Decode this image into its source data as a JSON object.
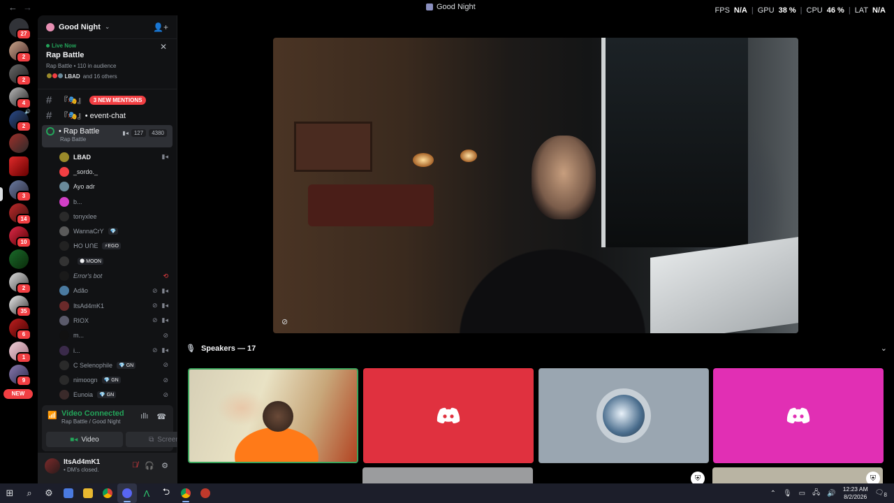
{
  "window": {
    "title": "Good Night"
  },
  "perf": {
    "fps_label": "FPS",
    "fps_value": "N/A",
    "gpu_label": "GPU",
    "gpu_value": "38 %",
    "cpu_label": "CPU",
    "cpu_value": "46 %",
    "lat_label": "LAT",
    "lat_value": "N/A",
    "sep": "|"
  },
  "rail": {
    "badges": [
      "27",
      "2",
      "2",
      "4",
      "2",
      "",
      "",
      "",
      "3",
      "14",
      "10",
      "",
      "2",
      "35",
      "6",
      "1",
      "9"
    ],
    "new_label": "NEW"
  },
  "sidebar": {
    "server_name": "Good Night",
    "live": {
      "live_label": "Live Now",
      "title": "Rap Battle",
      "meta": "Rap Battle • 110 in audience",
      "people_name": "LBAD",
      "people_rest": "and 16 others"
    },
    "channels": [
      {
        "name": "『🎭』",
        "badge": "3 NEW MENTIONS"
      },
      {
        "name": "『🎭』• event-chat"
      }
    ],
    "stage": {
      "name": "• Rap Battle",
      "sub": "Rap Battle",
      "count_a": "127",
      "count_b": "4380"
    },
    "members": [
      {
        "name": "LBAD",
        "color": "#9a8a2a"
      },
      {
        "name": "_sordo._",
        "color": "#f23f43"
      },
      {
        "name": "Ayo adr",
        "color": "#6a8a9a"
      },
      {
        "name": "b...",
        "color": "#d23fc7"
      },
      {
        "name": "tonyxlee",
        "color": "#2a2a2a"
      },
      {
        "name": "WannaCrY",
        "color": "#5a5a5a",
        "tag": "💎"
      },
      {
        "name": "ᕼO ᑌᑎE",
        "color": "#222",
        "tag": "⚡EGO"
      },
      {
        "name": "",
        "color": "#333",
        "tag": "🌑 MOON"
      },
      {
        "name": "Error's bot",
        "color": "#1a1a1a"
      },
      {
        "name": "Adão",
        "color": "#4a7aa0"
      },
      {
        "name": "ItsAd4mK1",
        "color": "#6a2a2a"
      },
      {
        "name": "RIOX",
        "color": "#5a5a6a"
      },
      {
        "name": "m...",
        "color": "#111"
      },
      {
        "name": "i...",
        "color": "#3a2a4a"
      },
      {
        "name": "C Selenophile",
        "color": "#2a2a2a",
        "tag": "💎 GN"
      },
      {
        "name": "nimoogn",
        "color": "#2a2a2a",
        "tag": "💎 GN"
      },
      {
        "name": "Eunoia",
        "color": "#3a2a2a",
        "tag": "💎 GN"
      }
    ],
    "voice": {
      "status": "Video Connected",
      "sub": "Rap Battle / Good Night",
      "video_label": "Video",
      "screen_label": "Screen"
    },
    "user": {
      "name": "ItsAd4mK1",
      "status": "• DM's closed."
    }
  },
  "main": {
    "speakers_label": "Speakers — 17"
  },
  "taskbar": {
    "time": "12:23 AM",
    "date": "8/2/2026",
    "notif_count": "8"
  },
  "colors": {
    "speaking_border": "#3ba55d",
    "discord_red": "#e0313f",
    "discord_pink": "#e12fb4",
    "online_green": "#23a55a"
  }
}
